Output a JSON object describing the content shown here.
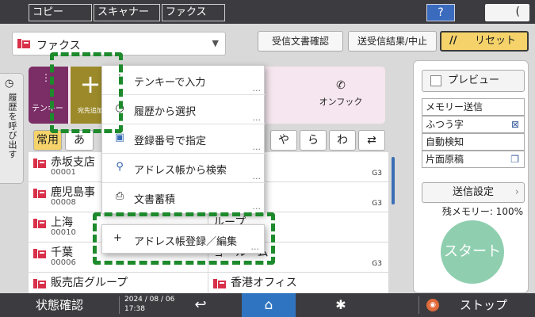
{
  "top_tabs": [
    {
      "label": "コピー"
    },
    {
      "label": "スキャナー"
    },
    {
      "label": "ファクス"
    }
  ],
  "help_label": "?",
  "moon_label": "(",
  "function_select": {
    "label": "ファクス"
  },
  "buttons": {
    "received_docs": "受信文書確認",
    "send_result": "送受信結果/中止",
    "reset": "リセット",
    "reset_icon": "//"
  },
  "history_tab": {
    "label": "履歴を呼び出す"
  },
  "panel": {
    "tenkey_label": "テンキー",
    "add_dest_label": "宛先追加",
    "onfook_label": "オンフック"
  },
  "index_tabs": [
    "常用",
    "あ",
    "や",
    "ら",
    "わ"
  ],
  "menu": {
    "items": [
      {
        "icon": "keypad-icon",
        "label": "テンキーで入力"
      },
      {
        "icon": "history-icon",
        "label": "履歴から選択"
      },
      {
        "icon": "register-number-icon",
        "label": "登録番号で指定"
      },
      {
        "icon": "search-icon",
        "label": "アドレス帳から検索"
      },
      {
        "icon": "stored-doc-icon",
        "label": "文書蓄積"
      }
    ],
    "more": "...",
    "address_edit": {
      "label": "アドレス帳登録／編集"
    }
  },
  "address_list": {
    "rows_left": [
      {
        "name": "赤坂支店",
        "num": "00001"
      },
      {
        "name": "鹿児島事",
        "num": "00008"
      },
      {
        "name": "上海",
        "num": "00010"
      },
      {
        "name": "千葉",
        "num": "00006"
      },
      {
        "name": "販売店グループ",
        "num": ""
      }
    ],
    "rows_right": [
      {
        "name": "課",
        "g3": "G3"
      },
      {
        "name": "課",
        "g3": "G3"
      },
      {
        "name": "ループ",
        "g3": ""
      },
      {
        "name": "ョールーム",
        "g3": "G3"
      },
      {
        "name": "香港オフィス",
        "g3": ""
      }
    ]
  },
  "right_panel": {
    "preview": "プレビュー",
    "settings": [
      {
        "label": "メモリー送信",
        "icon": ""
      },
      {
        "label": "ふつう字",
        "icon": "⊠"
      },
      {
        "label": "自動検知",
        "icon": ""
      },
      {
        "label": "片面原稿",
        "icon": "❐"
      }
    ],
    "send_settings": "送信設定",
    "memory": "残メモリー:  100%",
    "start": "スタート"
  },
  "bottom": {
    "status": "状態確認",
    "date": "2024 / 08 / 06",
    "time": "17:38",
    "stop": "ストップ"
  }
}
